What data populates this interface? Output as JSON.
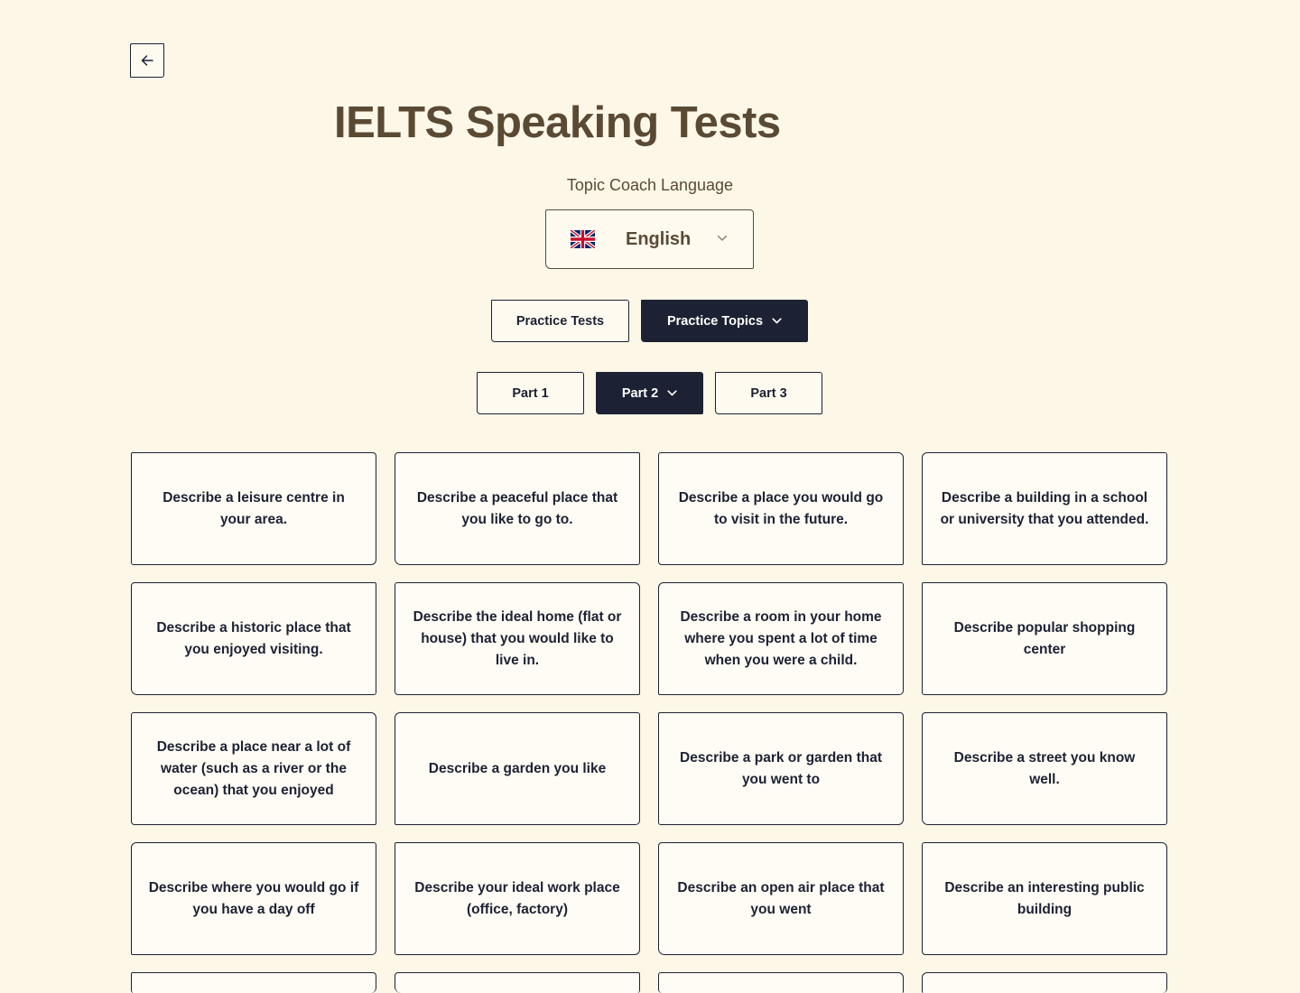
{
  "page_title": "IELTS Speaking Tests",
  "language": {
    "label": "Topic Coach Language",
    "selected": "English",
    "flag_icon": "uk-flag-icon"
  },
  "mode_tabs": {
    "practice_tests": "Practice Tests",
    "practice_topics": "Practice Topics",
    "active": "practice_topics"
  },
  "part_tabs": {
    "part1": "Part 1",
    "part2": "Part 2",
    "part3": "Part 3",
    "active": "part2"
  },
  "topics": [
    "Describe a leisure centre in your area.",
    "Describe a peaceful place that you like to go to.",
    "Describe a place you would go to visit in the future.",
    "Describe a building in a school or university that you attended.",
    "Describe a historic place that you enjoyed visiting.",
    "Describe the ideal home (flat or house) that you would like to live in.",
    "Describe a room in your home where you spent a lot of time when you were a child.",
    "Describe popular shopping center",
    "Describe a place near a lot of water (such as a river or the ocean) that you enjoyed",
    "Describe a garden you like",
    "Describe a park or garden that you went to",
    "Describe a street you know well.",
    "Describe where you would go if you have a day off",
    "Describe your ideal work place (office, factory)",
    "Describe an open air place that you went",
    "Describe an interesting public building",
    "",
    "",
    "",
    ""
  ],
  "colors": {
    "background": "#fdf7e8",
    "ink": "#1c2233",
    "title_brown": "#5a4a34"
  }
}
